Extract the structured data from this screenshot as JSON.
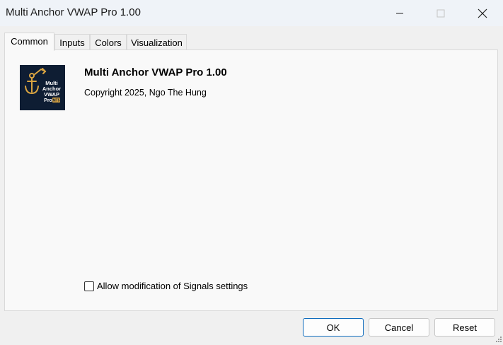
{
  "window": {
    "title": "Multi Anchor VWAP Pro 1.00",
    "controls": [
      "minimize-icon",
      "maximize-icon",
      "close-icon"
    ]
  },
  "tabs": [
    {
      "label": "Common",
      "active": true
    },
    {
      "label": "Inputs",
      "active": false
    },
    {
      "label": "Colors",
      "active": false
    },
    {
      "label": "Visualization",
      "active": false
    }
  ],
  "common": {
    "logo": {
      "lines": [
        "Multi",
        "Anchor",
        "VWAP",
        "Pro"
      ],
      "badge": "MT5",
      "icon": "anchor-icon"
    },
    "product_title": "Multi Anchor VWAP Pro 1.00",
    "copyright": "Copyright 2025, Ngo The Hung",
    "allow_signals_label": "Allow modification of Signals settings",
    "allow_signals_checked": false
  },
  "buttons": {
    "ok": "OK",
    "cancel": "Cancel",
    "reset": "Reset"
  },
  "colors": {
    "accent": "#0f6cbd",
    "logo_bg": "#0e1d33",
    "logo_gold": "#d9a441"
  }
}
